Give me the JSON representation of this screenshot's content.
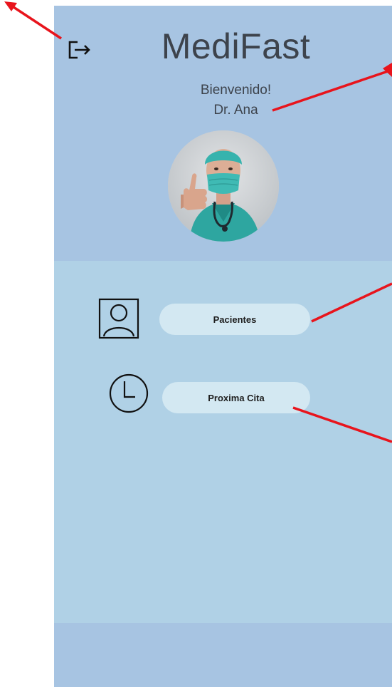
{
  "header": {
    "app_title": "MediFast",
    "welcome": "Bienvenido!",
    "doctor_name": "Dr. Ana"
  },
  "menu": {
    "items": [
      {
        "label": "Pacientes",
        "icon": "user-icon"
      },
      {
        "label": "Proxima Cita",
        "icon": "clock-icon"
      }
    ]
  },
  "icons": {
    "logout": "logout-icon"
  },
  "colors": {
    "header_bg": "#a7c4e2",
    "content_bg": "#b0d1e6",
    "button_bg": "#d3e8f2",
    "annotation_arrow": "#e8141c",
    "text": "#3d434c"
  }
}
